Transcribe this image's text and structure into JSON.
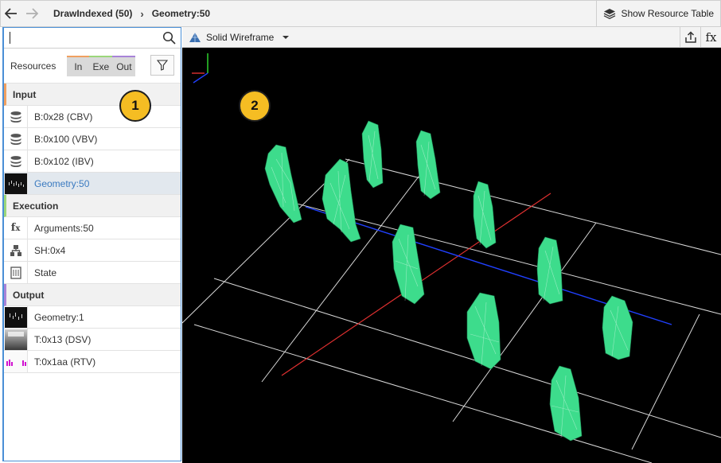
{
  "topbar": {
    "breadcrumbs": [
      "DrawIndexed (50)",
      "Geometry:50"
    ],
    "show_table_label": "Show Resource Table"
  },
  "left_panel": {
    "search": {
      "value": "",
      "placeholder": ""
    },
    "resources_label": "Resources",
    "filters": [
      {
        "label": "In",
        "color": "#f0a060"
      },
      {
        "label": "Exe",
        "color": "#9bd67a"
      },
      {
        "label": "Out",
        "color": "#a883d8"
      }
    ],
    "sections": [
      {
        "title": "Input",
        "items": [
          {
            "label": "B:0x28 (CBV)",
            "icon": "buffer-stack-icon"
          },
          {
            "label": "B:0x100 (VBV)",
            "icon": "buffer-stack-icon"
          },
          {
            "label": "B:0x102 (IBV)",
            "icon": "buffer-stack-icon"
          },
          {
            "label": "Geometry:50",
            "icon": "geometry-thumbnail",
            "selected": true
          }
        ]
      },
      {
        "title": "Execution",
        "items": [
          {
            "label": "Arguments:50",
            "icon": "fx-icon"
          },
          {
            "label": "SH:0x4",
            "icon": "shader-hierarchy-icon"
          },
          {
            "label": "State",
            "icon": "state-icon"
          }
        ]
      },
      {
        "title": "Output",
        "items": [
          {
            "label": "Geometry:1",
            "icon": "geometry-thumbnail"
          },
          {
            "label": "T:0x13 (DSV)",
            "icon": "depth-thumbnail"
          },
          {
            "label": "T:0x1aa (RTV)",
            "icon": "rtv-thumbnail"
          }
        ]
      }
    ]
  },
  "viewport": {
    "mode_label": "Solid Wireframe",
    "fx_label": "fx",
    "mesh_color": "#3ddc8c",
    "axis_colors": {
      "x": "#e03030",
      "y": "#30e030",
      "z": "#2040ff"
    }
  },
  "callouts": [
    "1",
    "2"
  ]
}
